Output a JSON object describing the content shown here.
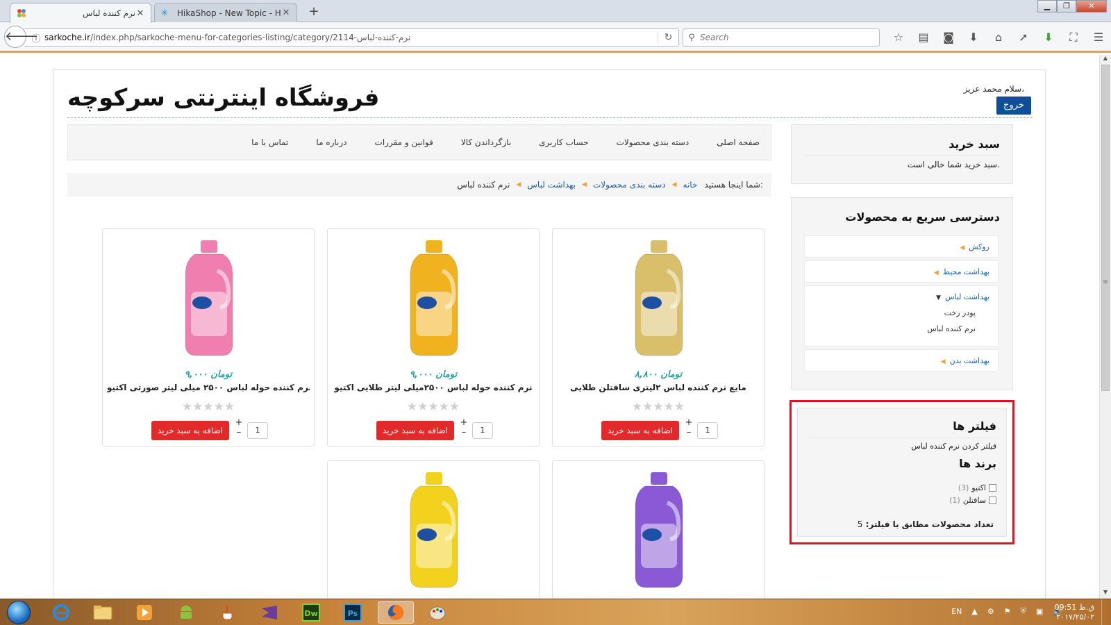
{
  "browser": {
    "tabs": [
      {
        "title": "نرم کننده لباس",
        "active": true
      },
      {
        "title": "HikaShop - New Topic - Hi...",
        "active": false
      }
    ],
    "url_host": "sarkoche.ir",
    "url_path": "/index.php/sarkoche-menu-for-categories-listing/category/2114-نرم-کننده-لباس",
    "search_placeholder": "Search"
  },
  "site": {
    "title": "فروشگاه اینترنتی سرکوچه",
    "greeting": "سلام محمد عزیز،",
    "logout": "خروج",
    "menu": [
      "صفحه اصلی",
      "دسته بندی محصولات",
      "حساب کاربری",
      "بازگرداندن کالا",
      "قوانین و مقررات",
      "درباره ما",
      "تماس با ما"
    ],
    "breadcrumb": {
      "label": "شما اینجا هستید:",
      "links": [
        "خانه",
        "دسته بندی محصولات",
        "بهداشت لباس"
      ],
      "current": "نرم کننده لباس"
    }
  },
  "products": [
    {
      "price": "۸,۸۰۰ تومان",
      "name": "مایع نرم کننده لباس ۲لیتری سافتلن طلایی",
      "qty": "1",
      "add": "اضافه به سبد خرید",
      "bottle_color": "#d9bf6a"
    },
    {
      "price": "۹,۰۰۰ تومان",
      "name": "نرم کننده حوله لباس ۲۵۰۰میلی لیتر طلایی اکتیو",
      "qty": "1",
      "add": "اضافه به سبد خرید",
      "bottle_color": "#f0b21e"
    },
    {
      "price": "۹,۰۰۰ تومان",
      "name": "نرم کننده حوله لباس ۲۵۰۰ میلی لیتر صورتی اکتیو",
      "qty": "1",
      "add": "اضافه به سبد خرید",
      "bottle_color": "#f07fb0"
    },
    {
      "bottle_color": "#8a5ad6"
    },
    {
      "bottle_color": "#f2d21c"
    }
  ],
  "sidebar": {
    "cart_title": "سبد خرید",
    "cart_empty": "سبد خرید شما خالی است.",
    "quick_title": "دسترسی سریع به محصولات",
    "quick_items": [
      "روکش",
      "بهداشت محیط",
      "بهداشت لباس",
      "بهداشت بدن"
    ],
    "quick_sub": [
      "پودر رخت",
      "نرم کننده لباس"
    ],
    "filters_title": "فیلتر ها",
    "filters_desc": "فیلتر کردن نرم کننده لباس",
    "brands_title": "برند ها",
    "brands": [
      {
        "name": "اکتیو",
        "count": "(3)"
      },
      {
        "name": "سافتلن",
        "count": "(1)"
      }
    ],
    "total_label": "تعداد محصولات مطابق با فیلتر:",
    "total_value": "5"
  },
  "taskbar": {
    "lang": "EN",
    "time": "09:51 ق.ظ",
    "date": "۲۰۱۷/۲۵/۰۲"
  }
}
